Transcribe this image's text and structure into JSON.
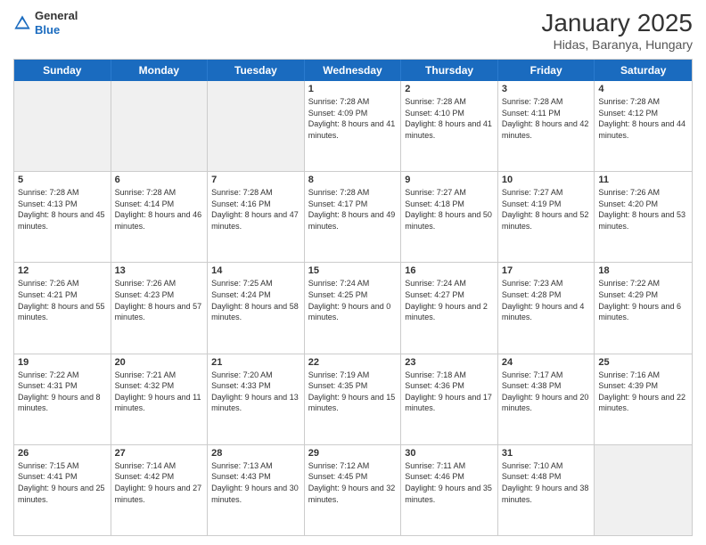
{
  "header": {
    "logo_line1": "General",
    "logo_line2": "Blue",
    "title": "January 2025",
    "subtitle": "Hidas, Baranya, Hungary"
  },
  "weekdays": [
    "Sunday",
    "Monday",
    "Tuesday",
    "Wednesday",
    "Thursday",
    "Friday",
    "Saturday"
  ],
  "weeks": [
    [
      {
        "day": "",
        "text": ""
      },
      {
        "day": "",
        "text": ""
      },
      {
        "day": "",
        "text": ""
      },
      {
        "day": "1",
        "text": "Sunrise: 7:28 AM\nSunset: 4:09 PM\nDaylight: 8 hours and 41 minutes."
      },
      {
        "day": "2",
        "text": "Sunrise: 7:28 AM\nSunset: 4:10 PM\nDaylight: 8 hours and 41 minutes."
      },
      {
        "day": "3",
        "text": "Sunrise: 7:28 AM\nSunset: 4:11 PM\nDaylight: 8 hours and 42 minutes."
      },
      {
        "day": "4",
        "text": "Sunrise: 7:28 AM\nSunset: 4:12 PM\nDaylight: 8 hours and 44 minutes."
      }
    ],
    [
      {
        "day": "5",
        "text": "Sunrise: 7:28 AM\nSunset: 4:13 PM\nDaylight: 8 hours and 45 minutes."
      },
      {
        "day": "6",
        "text": "Sunrise: 7:28 AM\nSunset: 4:14 PM\nDaylight: 8 hours and 46 minutes."
      },
      {
        "day": "7",
        "text": "Sunrise: 7:28 AM\nSunset: 4:16 PM\nDaylight: 8 hours and 47 minutes."
      },
      {
        "day": "8",
        "text": "Sunrise: 7:28 AM\nSunset: 4:17 PM\nDaylight: 8 hours and 49 minutes."
      },
      {
        "day": "9",
        "text": "Sunrise: 7:27 AM\nSunset: 4:18 PM\nDaylight: 8 hours and 50 minutes."
      },
      {
        "day": "10",
        "text": "Sunrise: 7:27 AM\nSunset: 4:19 PM\nDaylight: 8 hours and 52 minutes."
      },
      {
        "day": "11",
        "text": "Sunrise: 7:26 AM\nSunset: 4:20 PM\nDaylight: 8 hours and 53 minutes."
      }
    ],
    [
      {
        "day": "12",
        "text": "Sunrise: 7:26 AM\nSunset: 4:21 PM\nDaylight: 8 hours and 55 minutes."
      },
      {
        "day": "13",
        "text": "Sunrise: 7:26 AM\nSunset: 4:23 PM\nDaylight: 8 hours and 57 minutes."
      },
      {
        "day": "14",
        "text": "Sunrise: 7:25 AM\nSunset: 4:24 PM\nDaylight: 8 hours and 58 minutes."
      },
      {
        "day": "15",
        "text": "Sunrise: 7:24 AM\nSunset: 4:25 PM\nDaylight: 9 hours and 0 minutes."
      },
      {
        "day": "16",
        "text": "Sunrise: 7:24 AM\nSunset: 4:27 PM\nDaylight: 9 hours and 2 minutes."
      },
      {
        "day": "17",
        "text": "Sunrise: 7:23 AM\nSunset: 4:28 PM\nDaylight: 9 hours and 4 minutes."
      },
      {
        "day": "18",
        "text": "Sunrise: 7:22 AM\nSunset: 4:29 PM\nDaylight: 9 hours and 6 minutes."
      }
    ],
    [
      {
        "day": "19",
        "text": "Sunrise: 7:22 AM\nSunset: 4:31 PM\nDaylight: 9 hours and 8 minutes."
      },
      {
        "day": "20",
        "text": "Sunrise: 7:21 AM\nSunset: 4:32 PM\nDaylight: 9 hours and 11 minutes."
      },
      {
        "day": "21",
        "text": "Sunrise: 7:20 AM\nSunset: 4:33 PM\nDaylight: 9 hours and 13 minutes."
      },
      {
        "day": "22",
        "text": "Sunrise: 7:19 AM\nSunset: 4:35 PM\nDaylight: 9 hours and 15 minutes."
      },
      {
        "day": "23",
        "text": "Sunrise: 7:18 AM\nSunset: 4:36 PM\nDaylight: 9 hours and 17 minutes."
      },
      {
        "day": "24",
        "text": "Sunrise: 7:17 AM\nSunset: 4:38 PM\nDaylight: 9 hours and 20 minutes."
      },
      {
        "day": "25",
        "text": "Sunrise: 7:16 AM\nSunset: 4:39 PM\nDaylight: 9 hours and 22 minutes."
      }
    ],
    [
      {
        "day": "26",
        "text": "Sunrise: 7:15 AM\nSunset: 4:41 PM\nDaylight: 9 hours and 25 minutes."
      },
      {
        "day": "27",
        "text": "Sunrise: 7:14 AM\nSunset: 4:42 PM\nDaylight: 9 hours and 27 minutes."
      },
      {
        "day": "28",
        "text": "Sunrise: 7:13 AM\nSunset: 4:43 PM\nDaylight: 9 hours and 30 minutes."
      },
      {
        "day": "29",
        "text": "Sunrise: 7:12 AM\nSunset: 4:45 PM\nDaylight: 9 hours and 32 minutes."
      },
      {
        "day": "30",
        "text": "Sunrise: 7:11 AM\nSunset: 4:46 PM\nDaylight: 9 hours and 35 minutes."
      },
      {
        "day": "31",
        "text": "Sunrise: 7:10 AM\nSunset: 4:48 PM\nDaylight: 9 hours and 38 minutes."
      },
      {
        "day": "",
        "text": ""
      }
    ]
  ]
}
